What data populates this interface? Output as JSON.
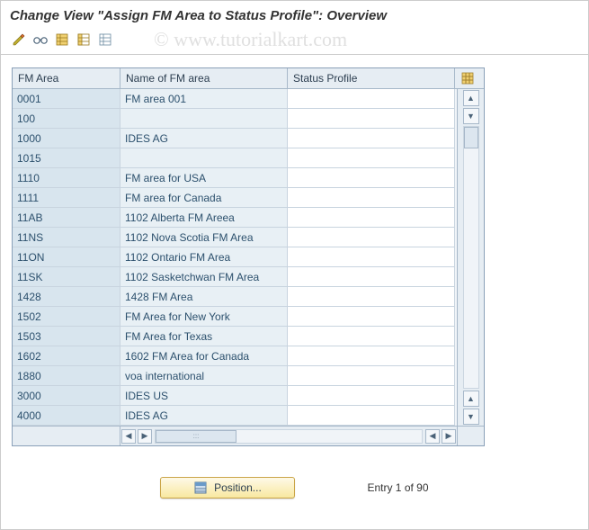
{
  "title": "Change View \"Assign FM Area to Status Profile\": Overview",
  "watermark": "© www.tutorialkart.com",
  "toolbar": {
    "btn1": "toggle-display-change",
    "btn2": "glasses-other-view",
    "btn3": "select-all",
    "btn4": "select-block",
    "btn5": "deselect-all"
  },
  "columns": {
    "c1": "FM Area",
    "c2": "Name of FM area",
    "c3": "Status Profile"
  },
  "rows": [
    {
      "fm": "0001",
      "name": "FM area 001",
      "status": ""
    },
    {
      "fm": "100",
      "name": "",
      "status": ""
    },
    {
      "fm": "1000",
      "name": "IDES AG",
      "status": ""
    },
    {
      "fm": "1015",
      "name": "",
      "status": ""
    },
    {
      "fm": "1110",
      "name": "FM area for USA",
      "status": ""
    },
    {
      "fm": "1111",
      "name": "FM area for Canada",
      "status": ""
    },
    {
      "fm": "11AB",
      "name": "1102 Alberta FM Areea",
      "status": ""
    },
    {
      "fm": "11NS",
      "name": "1102 Nova Scotia FM Area",
      "status": ""
    },
    {
      "fm": "11ON",
      "name": "1102 Ontario FM Area",
      "status": ""
    },
    {
      "fm": "11SK",
      "name": "1102 Sasketchwan FM Area",
      "status": ""
    },
    {
      "fm": "1428",
      "name": "1428 FM Area",
      "status": ""
    },
    {
      "fm": "1502",
      "name": "FM Area for New York",
      "status": ""
    },
    {
      "fm": "1503",
      "name": "FM Area for Texas",
      "status": ""
    },
    {
      "fm": "1602",
      "name": "1602 FM Area for Canada",
      "status": ""
    },
    {
      "fm": "1880",
      "name": "voa international",
      "status": ""
    },
    {
      "fm": "3000",
      "name": "IDES US",
      "status": ""
    },
    {
      "fm": "4000",
      "name": "IDES AG",
      "status": ""
    }
  ],
  "footer": {
    "position_label": "Position...",
    "entry_text": "Entry 1 of 90"
  }
}
